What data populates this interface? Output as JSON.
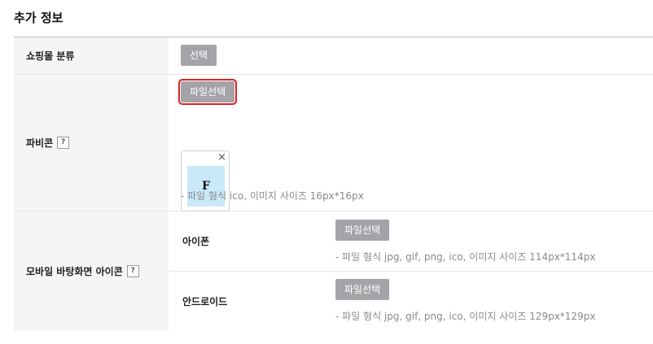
{
  "section": {
    "title": "추가 정보"
  },
  "rows": {
    "category": {
      "label": "쇼핑몰 분류",
      "button": "선택"
    },
    "favicon": {
      "label": "파비콘",
      "help": "?",
      "button": "파일선택",
      "preview_letter": "F",
      "close_glyph": "×",
      "hint": "- 파일 형식 ico, 이미지 사이즈 16px*16px"
    },
    "mobile": {
      "label": "모바일 바탕화면 아이콘",
      "help": "?",
      "iphone": {
        "label": "아이폰",
        "button": "파일선택",
        "hint": "- 파일 형식 jpg, gif, png, ico, 이미지 사이즈 114px*114px"
      },
      "android": {
        "label": "안드로이드",
        "button": "파일선택",
        "hint": "- 파일 형식 jpg, gif, png, ico, 이미지 사이즈 129px*129px"
      }
    }
  },
  "colors": {
    "button_bg": "#a4a4a8",
    "highlight": "#e02020",
    "header_bg": "#f5f5f5",
    "preview_bg": "#c9e9f9"
  }
}
